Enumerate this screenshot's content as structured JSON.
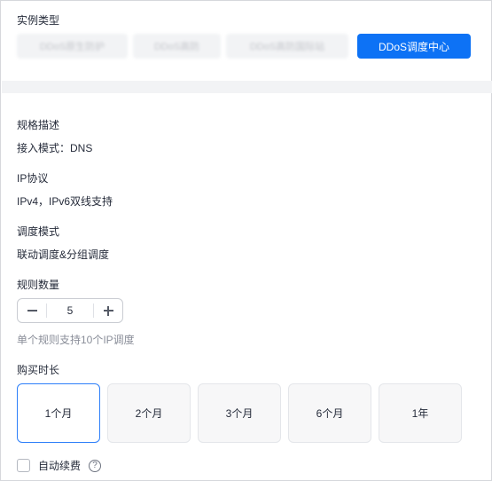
{
  "instance_type": {
    "label": "实例类型",
    "options": [
      {
        "label": "DDoS原生防护",
        "active": false
      },
      {
        "label": "DDoS高防",
        "active": false
      },
      {
        "label": "DDoS高防国际站",
        "active": false
      },
      {
        "label": "DDoS调度中心",
        "active": true
      }
    ]
  },
  "spec": {
    "label": "规格描述",
    "value": "接入模式：DNS"
  },
  "ip_protocol": {
    "label": "IP协议",
    "value": "IPv4，IPv6双线支持"
  },
  "schedule_mode": {
    "label": "调度模式",
    "value": "联动调度&分组调度"
  },
  "rule_count": {
    "label": "规则数量",
    "value": "5",
    "hint": "单个规则支持10个IP调度"
  },
  "duration": {
    "label": "购买时长",
    "options": [
      {
        "label": "1个月",
        "active": true
      },
      {
        "label": "2个月",
        "active": false
      },
      {
        "label": "3个月",
        "active": false
      },
      {
        "label": "6个月",
        "active": false
      },
      {
        "label": "1年",
        "active": false
      }
    ]
  },
  "auto_renew": {
    "label": "自动续费",
    "checked": false,
    "help_icon": "?"
  }
}
